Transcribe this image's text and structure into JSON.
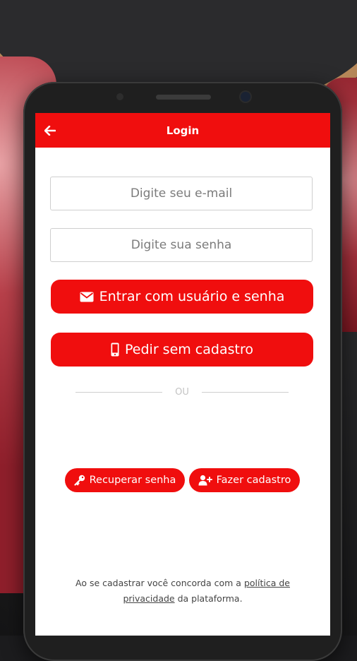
{
  "appbar": {
    "title": "Login",
    "back_icon": "arrow-left-icon"
  },
  "form": {
    "email_placeholder": "Digite seu e-mail",
    "email_value": "",
    "password_placeholder": "Digite sua senha",
    "password_value": ""
  },
  "buttons": {
    "login_label": "Entrar com usuário e senha",
    "login_icon": "envelope-icon",
    "guest_label": "Pedir sem cadastro",
    "guest_icon": "mobile-phone-icon",
    "divider_text": "OU",
    "recover_label": "Recuperar senha",
    "recover_icon": "key-icon",
    "register_label": "Fazer cadastro",
    "register_icon": "user-plus-icon"
  },
  "legal": {
    "prefix": "Ao se cadastrar você concorda com a ",
    "link_text": "política de privacidade",
    "suffix": " da plataforma."
  },
  "colors": {
    "accent": "#f00e0e",
    "field_border": "#cfcfcf",
    "placeholder": "#7b7b7b"
  }
}
